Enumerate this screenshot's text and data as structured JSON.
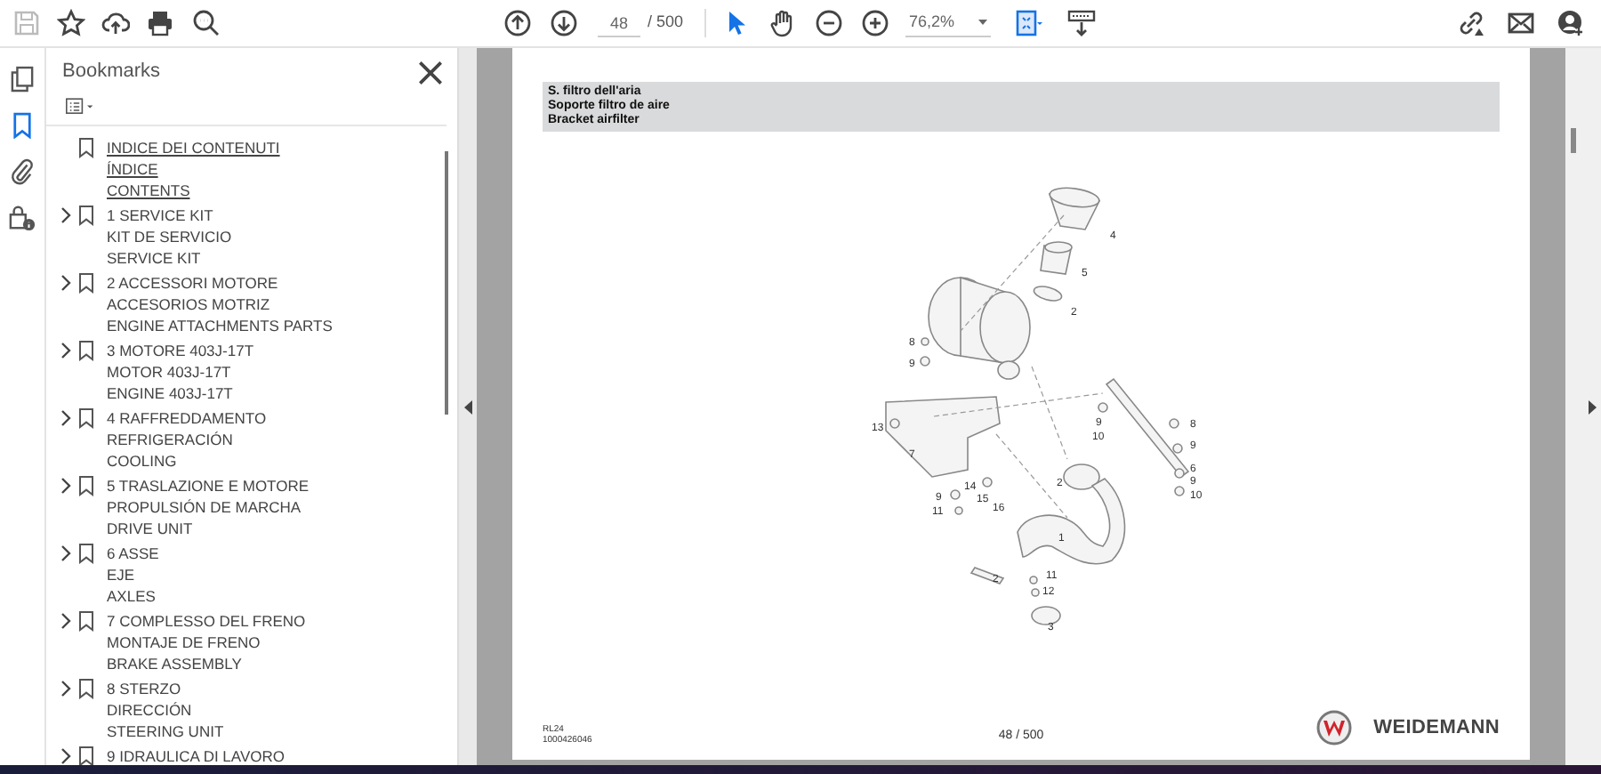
{
  "toolbar": {
    "save_disabled": true,
    "page_field": "48",
    "page_total": "/ 500",
    "zoom_field": "76,2%",
    "tools": [
      {
        "kind": "select",
        "selected": true
      },
      {
        "kind": "hand",
        "selected": false
      }
    ]
  },
  "side_rail": [
    {
      "kind": "pages",
      "selected": false
    },
    {
      "kind": "bookmarks",
      "selected": true
    },
    {
      "kind": "attachments",
      "selected": false
    },
    {
      "kind": "security",
      "selected": false
    }
  ],
  "bookmarks_panel": {
    "title": "Bookmarks",
    "items": [
      {
        "lines": [
          "INDICE DEI CONTENUTI",
          "ÍNDICE",
          "CONTENTS"
        ],
        "has_children": false,
        "selected": true
      },
      {
        "lines": [
          "1 SERVICE KIT",
          "KIT DE SERVICIO",
          "SERVICE KIT"
        ],
        "has_children": true,
        "expanded": false,
        "selected": false
      },
      {
        "lines": [
          "2 ACCESSORI MOTORE",
          "ACCESORIOS MOTRIZ",
          "ENGINE ATTACHMENTS PARTS"
        ],
        "has_children": true,
        "expanded": false,
        "selected": false
      },
      {
        "lines": [
          "3 MOTORE 403J-17T",
          "MOTOR 403J-17T",
          "ENGINE 403J-17T"
        ],
        "has_children": true,
        "expanded": false,
        "selected": false
      },
      {
        "lines": [
          "4 RAFFREDDAMENTO",
          "REFRIGERACIÓN",
          "COOLING"
        ],
        "has_children": true,
        "expanded": false,
        "selected": false
      },
      {
        "lines": [
          "5 TRASLAZIONE E MOTORE",
          "PROPULSIÓN DE MARCHA",
          "DRIVE UNIT"
        ],
        "has_children": true,
        "expanded": false,
        "selected": false
      },
      {
        "lines": [
          "6 ASSE",
          "EJE",
          "AXLES"
        ],
        "has_children": true,
        "expanded": false,
        "selected": false
      },
      {
        "lines": [
          "7 COMPLESSO DEL FRENO",
          "MONTAJE DE FRENO",
          "BRAKE ASSEMBLY"
        ],
        "has_children": true,
        "expanded": false,
        "selected": false
      },
      {
        "lines": [
          "8 STERZO",
          "DIRECCIÓN",
          "STEERING UNIT"
        ],
        "has_children": true,
        "expanded": false,
        "selected": false
      },
      {
        "lines": [
          "9 IDRAULICA DI LAVORO"
        ],
        "has_children": true,
        "expanded": false,
        "selected": false
      }
    ]
  },
  "page": {
    "header_lines": [
      "S. filtro dell'aria",
      "Soporte filtro de aire",
      "Bracket airfilter"
    ],
    "callouts": [
      "4",
      "5",
      "2",
      "8",
      "9",
      "13",
      "7",
      "9",
      "10",
      "8",
      "9",
      "6",
      "9",
      "10",
      "2",
      "14",
      "15",
      "16",
      "9",
      "11",
      "1",
      "2",
      "11",
      "12",
      "3"
    ],
    "footer_codes": [
      "RL24",
      "1000426046"
    ],
    "page_number": "48 / 500",
    "brand": "WEIDEMANN"
  }
}
